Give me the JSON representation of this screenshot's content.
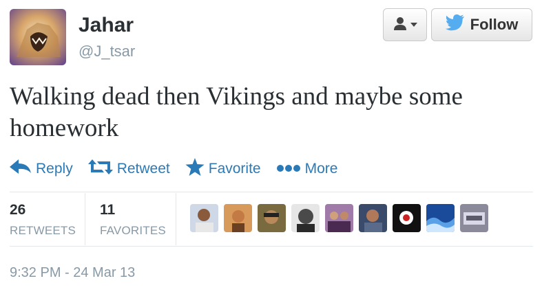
{
  "user": {
    "name": "Jahar",
    "handle": "@J_tsar"
  },
  "buttons": {
    "follow_label": "Follow"
  },
  "tweet": {
    "text": "Walking dead then Vikings and maybe some homework"
  },
  "actions": [
    {
      "label": "Reply",
      "icon": "reply-icon"
    },
    {
      "label": "Retweet",
      "icon": "retweet-icon"
    },
    {
      "label": "Favorite",
      "icon": "star-icon"
    },
    {
      "label": "More",
      "icon": "more-icon"
    }
  ],
  "stats": {
    "retweets": {
      "count": "26",
      "label": "RETWEETS"
    },
    "favorites": {
      "count": "11",
      "label": "FAVORITES"
    }
  },
  "favoriters_count_shown": 9,
  "timestamp": "9:32 PM - 24 Mar 13",
  "colors": {
    "link": "#2a7ab8",
    "twitter_blue": "#55acee",
    "muted": "#8899a6",
    "text": "#292f33"
  }
}
